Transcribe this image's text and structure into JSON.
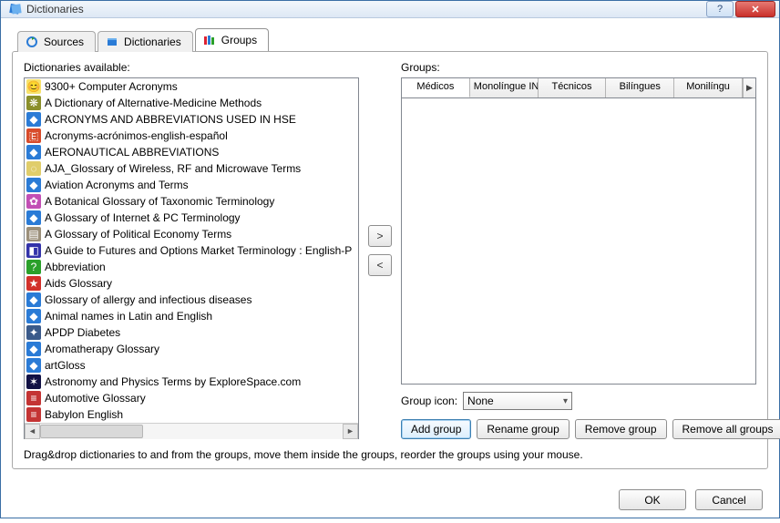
{
  "window": {
    "title": "Dictionaries"
  },
  "tabs": [
    {
      "label": "Sources",
      "icon": "refresh-icon"
    },
    {
      "label": "Dictionaries",
      "icon": "book-icon"
    },
    {
      "label": "Groups",
      "icon": "books-icon"
    }
  ],
  "active_tab": 2,
  "left": {
    "label": "Dictionaries available:",
    "items": [
      {
        "label": "9300+ Computer Acronyms",
        "icon": "😊",
        "bg": "#f7e26b"
      },
      {
        "label": "A Dictionary of Alternative-Medicine Methods",
        "icon": "❋",
        "bg": "#8a8f2b"
      },
      {
        "label": "ACRONYMS AND ABBREVIATIONS USED IN HSE",
        "icon": "◆",
        "bg": "#2a7bd6"
      },
      {
        "label": "Acronyms-acrónimos-english-español",
        "icon": "🇪",
        "bg": "#d84b2a"
      },
      {
        "label": "AERONAUTICAL ABBREVIATIONS",
        "icon": "◆",
        "bg": "#2a7bd6"
      },
      {
        "label": "AJA_Glossary of Wireless, RF and Microwave Terms",
        "icon": "◌",
        "bg": "#e0cd6a"
      },
      {
        "label": "Aviation Acronyms and Terms",
        "icon": "◆",
        "bg": "#2a7bd6"
      },
      {
        "label": "A Botanical Glossary of Taxonomic Terminology",
        "icon": "✿",
        "bg": "#c24fb5"
      },
      {
        "label": "A Glossary of Internet & PC Terminology",
        "icon": "◆",
        "bg": "#2a7bd6"
      },
      {
        "label": "A Glossary of Political Economy Terms",
        "icon": "▤",
        "bg": "#9b8f7a"
      },
      {
        "label": "A Guide to Futures and Options Market Terminology : English-P",
        "icon": "◧",
        "bg": "#3333aa"
      },
      {
        "label": "Abbreviation",
        "icon": "?",
        "bg": "#2aa02a"
      },
      {
        "label": "Aids Glossary",
        "icon": "★",
        "bg": "#d2302a"
      },
      {
        "label": "Glossary of allergy and infectious diseases",
        "icon": "◆",
        "bg": "#2a7bd6"
      },
      {
        "label": "Animal names in Latin and English",
        "icon": "◆",
        "bg": "#2a7bd6"
      },
      {
        "label": "APDP Diabetes",
        "icon": "✦",
        "bg": "#3a5a8a"
      },
      {
        "label": "Aromatherapy Glossary",
        "icon": "◆",
        "bg": "#2a7bd6"
      },
      {
        "label": "artGloss",
        "icon": "◆",
        "bg": "#2a7bd6"
      },
      {
        "label": "Astronomy and Physics Terms by ExploreSpace.com",
        "icon": "✶",
        "bg": "#111144"
      },
      {
        "label": "Automotive Glossary",
        "icon": "≡",
        "bg": "#c43434"
      },
      {
        "label": "Babylon English",
        "icon": "≡",
        "bg": "#c43434"
      }
    ]
  },
  "mid": {
    "right": ">",
    "left": "<"
  },
  "right": {
    "label": "Groups:",
    "tabs": [
      "Médicos",
      "Monolíngue IN",
      "Técnicos",
      "Bilíngues",
      "Monilíngu"
    ],
    "active_tab": 0,
    "icon_label": "Group icon:",
    "icon_value": "None",
    "buttons": {
      "add": "Add group",
      "rename": "Rename group",
      "remove": "Remove group",
      "remove_all": "Remove all groups"
    }
  },
  "hint": "Drag&drop dictionaries to and from the groups, move them inside the groups, reorder the groups using your mouse.",
  "dialog": {
    "ok": "OK",
    "cancel": "Cancel"
  }
}
